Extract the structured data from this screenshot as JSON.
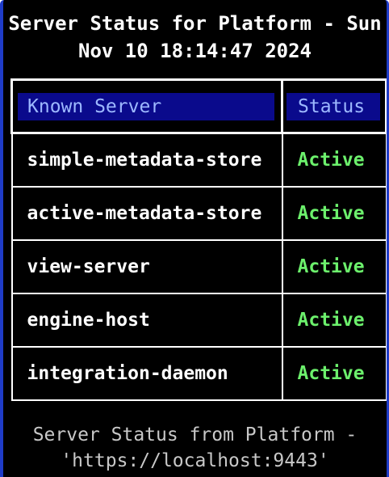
{
  "title": "Server Status for Platform - Sun\nNov 10 18:14:47 2024",
  "table": {
    "headers": [
      "Known Server",
      "Status"
    ],
    "rows": [
      {
        "server": "simple-metadata-store",
        "status": "Active"
      },
      {
        "server": "active-metadata-store",
        "status": "Active"
      },
      {
        "server": "view-server",
        "status": "Active"
      },
      {
        "server": "engine-host",
        "status": "Active"
      },
      {
        "server": "integration-daemon",
        "status": "Active"
      }
    ]
  },
  "footer": "Server Status from Platform -\n'https://localhost:9443'",
  "colors": {
    "background": "#000000",
    "window_border": "#1f3cc8",
    "header_bg": "#0a0a8c",
    "header_text": "#9db8ff",
    "active_status": "#6cf06c",
    "text": "#ffffff",
    "footer_text": "#c8c8c8"
  }
}
